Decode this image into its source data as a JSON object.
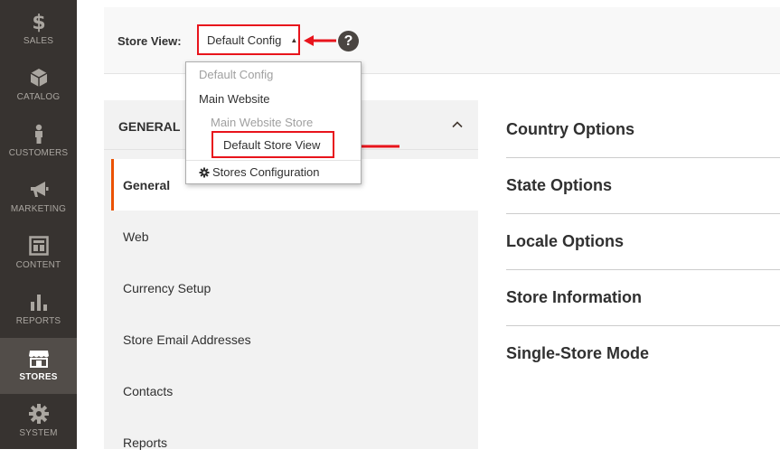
{
  "sidebar": {
    "items": [
      {
        "label": "SALES",
        "icon": "dollar-icon"
      },
      {
        "label": "CATALOG",
        "icon": "cube-icon"
      },
      {
        "label": "CUSTOMERS",
        "icon": "person-icon"
      },
      {
        "label": "MARKETING",
        "icon": "megaphone-icon"
      },
      {
        "label": "CONTENT",
        "icon": "layout-icon"
      },
      {
        "label": "REPORTS",
        "icon": "bar-chart-icon"
      },
      {
        "label": "STORES",
        "icon": "storefront-icon",
        "active": true
      },
      {
        "label": "SYSTEM",
        "icon": "gear-icon"
      }
    ]
  },
  "scope": {
    "label": "Store View:",
    "selected": "Default Config",
    "help": "?"
  },
  "dropdown": {
    "default_config": "Default Config",
    "website": "Main Website",
    "store": "Main Website Store",
    "store_view": "Default Store View",
    "stores_config": "Stores Configuration"
  },
  "tabs": {
    "title": "GENERAL",
    "items": [
      {
        "label": "General",
        "active": true
      },
      {
        "label": "Web"
      },
      {
        "label": "Currency Setup"
      },
      {
        "label": "Store Email Addresses"
      },
      {
        "label": "Contacts"
      },
      {
        "label": "Reports"
      }
    ]
  },
  "sections": [
    "Country Options",
    "State Options",
    "Locale Options",
    "Store Information",
    "Single-Store Mode"
  ],
  "colors": {
    "sidebar_bg": "#373330",
    "sidebar_active": "#524d49",
    "annotation_red": "#e8141c",
    "active_tab_accent": "#eb5202"
  }
}
